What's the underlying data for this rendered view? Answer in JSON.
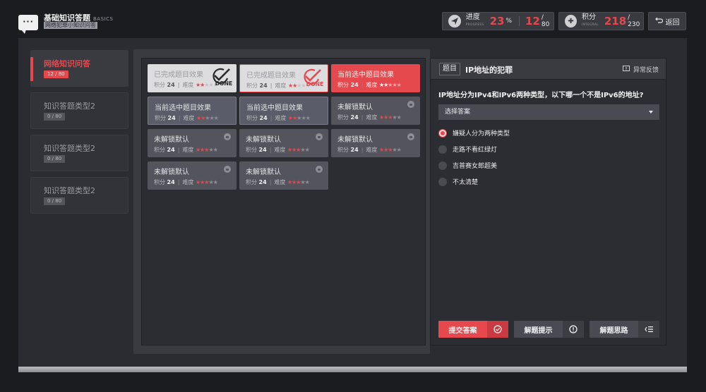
{
  "header": {
    "title": "基础知识答题",
    "title_en": "BASICS",
    "subtitle": "网络犯罪小知识问答",
    "progress": {
      "label": "进度",
      "label_en": "PROGRESS",
      "percent": "23",
      "percent_unit": "%",
      "count": "12",
      "total": "/ 80"
    },
    "score": {
      "label": "积分",
      "label_en": "INTEGRAL",
      "value": "218",
      "total": "/ 230"
    },
    "back_label": "返回"
  },
  "sidebar": {
    "items": [
      {
        "label": "网络知识问答",
        "badge": "12 / 80",
        "active": true
      },
      {
        "label": "知识答题类型2",
        "badge": "0 / 80",
        "active": false
      },
      {
        "label": "知识答题类型2",
        "badge": "0 / 80",
        "active": false
      },
      {
        "label": "知识答题类型2",
        "badge": "0 / 80",
        "active": false
      }
    ]
  },
  "cards": [
    {
      "title": "已完成题目效果",
      "score_label": "积分",
      "score": "24",
      "diff_label": "难度",
      "stars": 2,
      "state": "done",
      "stamp": "DONE"
    },
    {
      "title": "已完成题目效果",
      "score_label": "积分",
      "score": "24",
      "diff_label": "难度",
      "stars": 2,
      "state": "done-red",
      "stamp": "DONE"
    },
    {
      "title": "当前选中题目效果",
      "score_label": "积分",
      "score": "24",
      "diff_label": "难度",
      "stars": 2,
      "state": "selected"
    },
    {
      "title": "当前选中题目效果",
      "score_label": "积分",
      "score": "24",
      "diff_label": "难度",
      "stars": 2,
      "state": "current"
    },
    {
      "title": "当前选中题目效果",
      "score_label": "积分",
      "score": "24",
      "diff_label": "难度",
      "stars": 2,
      "state": "current"
    },
    {
      "title": "未解锁默认",
      "score_label": "积分",
      "score": "24",
      "diff_label": "难度",
      "stars": 3,
      "state": "locked"
    },
    {
      "title": "未解锁默认",
      "score_label": "积分",
      "score": "24",
      "diff_label": "难度",
      "stars": 3,
      "state": "locked"
    },
    {
      "title": "未解锁默认",
      "score_label": "积分",
      "score": "24",
      "diff_label": "难度",
      "stars": 3,
      "state": "locked"
    },
    {
      "title": "未解锁默认",
      "score_label": "积分",
      "score": "24",
      "diff_label": "难度",
      "stars": 3,
      "state": "locked"
    },
    {
      "title": "未解锁默认",
      "score_label": "积分",
      "score": "24",
      "diff_label": "难度",
      "stars": 3,
      "state": "locked"
    },
    {
      "title": "未解锁默认",
      "score_label": "积分",
      "score": "24",
      "diff_label": "难度",
      "stars": 3,
      "state": "locked"
    }
  ],
  "question": {
    "tag": "题目",
    "title": "IP地址的犯罪",
    "feedback_label": "异常反馈",
    "text": "IP地址分为IPv4和IPv6两种类型，以下哪一个不是IPv6的地址?",
    "select_placeholder": "选择答案",
    "options": [
      {
        "label": "嫌疑人分为两种类型",
        "selected": true
      },
      {
        "label": "走路不看红绿灯",
        "selected": false
      },
      {
        "label": "吉普赛女郎超美",
        "selected": false
      },
      {
        "label": "不太清楚",
        "selected": false
      }
    ],
    "actions": {
      "submit": "提交答案",
      "hint": "解题提示",
      "approach": "解题思路"
    }
  },
  "colors": {
    "accent": "#e5484d",
    "background": "#1b1c20",
    "panel": "#2b2c31"
  }
}
